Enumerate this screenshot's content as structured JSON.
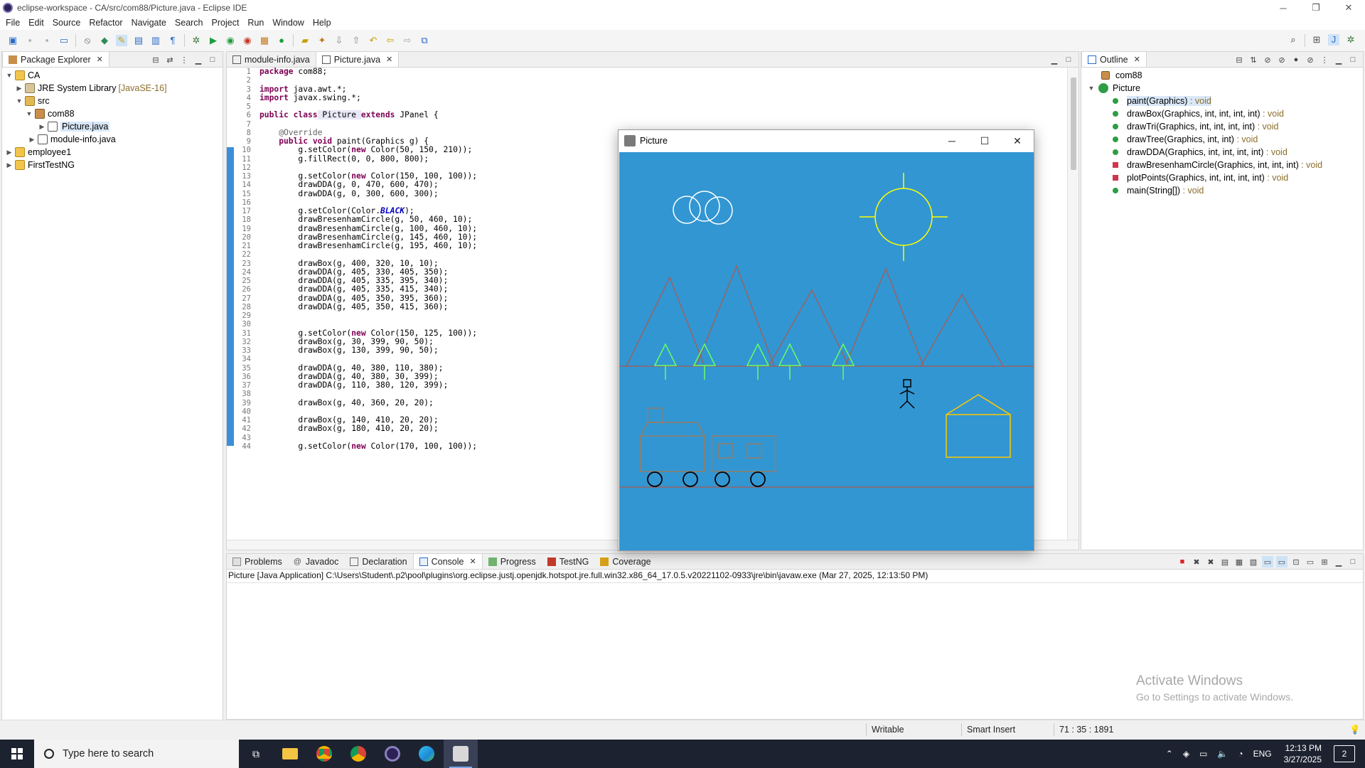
{
  "window": {
    "title": "eclipse-workspace - CA/src/com88/Picture.java - Eclipse IDE",
    "controls": [
      "─",
      "❐",
      "✕"
    ]
  },
  "menu": [
    "File",
    "Edit",
    "Source",
    "Refactor",
    "Navigate",
    "Search",
    "Project",
    "Run",
    "Window",
    "Help"
  ],
  "package_explorer": {
    "tab_label": "Package Explorer",
    "items": [
      {
        "label": "CA",
        "decor": ""
      },
      {
        "label": "JRE System Library",
        "decor": "[JavaSE-16]"
      },
      {
        "label": "src",
        "decor": ""
      },
      {
        "label": "com88",
        "decor": ""
      },
      {
        "label": "Picture.java",
        "decor": ""
      },
      {
        "label": "module-info.java",
        "decor": ""
      },
      {
        "label": "employee1",
        "decor": ""
      },
      {
        "label": "FirstTestNG",
        "decor": ""
      }
    ]
  },
  "editor": {
    "tabs": [
      {
        "label": "module-info.java"
      },
      {
        "label": "Picture.java"
      }
    ],
    "line_numbers": [
      "1",
      "2",
      "3",
      "4",
      "5",
      "6",
      "7",
      "8",
      "9",
      "10",
      "11",
      "12",
      "13",
      "14",
      "15",
      "16",
      "17",
      "18",
      "19",
      "20",
      "21",
      "22",
      "23",
      "24",
      "25",
      "26",
      "27",
      "28",
      "29",
      "30",
      "31",
      "32",
      "33",
      "34",
      "35",
      "36",
      "37",
      "38",
      "39",
      "40",
      "41",
      "42",
      "43",
      "44"
    ],
    "code": {
      "l1_kw": "package",
      "l1_rest": " com88;",
      "l3_kw": "import",
      "l3_rest": " java.awt.*;",
      "l4_kw": "import",
      "l4_rest": " javax.swing.*;",
      "l6_kw1": "public class",
      "l6_mid": " Picture ",
      "l6_kw2": "extends",
      "l6_rest": " JPanel {",
      "l8_ann": "    @Override",
      "l9_kw": "    public void",
      "l9_rest": " paint(Graphics g) {",
      "l10_a": "        g.setColor(",
      "l10_kw": "new",
      "l10_b": " Color(50, 150, 210));",
      "l11": "        g.fillRect(0, 0, 800, 800);",
      "l13_a": "        g.setColor(",
      "l13_kw": "new",
      "l13_b": " Color(150, 100, 100));",
      "l14": "        drawDDA(g, 0, 470, 600, 470);",
      "l15": "        drawDDA(g, 0, 300, 600, 300);",
      "l17_a": "        g.setColor(Color.",
      "l17_c": "BLACK",
      "l17_b": ");",
      "l18": "        drawBresenhamCircle(g, 50, 460, 10);",
      "l19": "        drawBresenhamCircle(g, 100, 460, 10);",
      "l20": "        drawBresenhamCircle(g, 145, 460, 10);",
      "l21": "        drawBresenhamCircle(g, 195, 460, 10);",
      "l23": "        drawBox(g, 400, 320, 10, 10);",
      "l24": "        drawDDA(g, 405, 330, 405, 350);",
      "l25": "        drawDDA(g, 405, 335, 395, 340);",
      "l26": "        drawDDA(g, 405, 335, 415, 340);",
      "l27": "        drawDDA(g, 405, 350, 395, 360);",
      "l28": "        drawDDA(g, 405, 350, 415, 360);",
      "l31_a": "        g.setColor(",
      "l31_kw": "new",
      "l31_b": " Color(150, 125, 100));",
      "l32": "        drawBox(g, 30, 399, 90, 50);",
      "l33": "        drawBox(g, 130, 399, 90, 50);",
      "l35": "        drawDDA(g, 40, 380, 110, 380);",
      "l36": "        drawDDA(g, 40, 380, 30, 399);",
      "l37": "        drawDDA(g, 110, 380, 120, 399);",
      "l39": "        drawBox(g, 40, 360, 20, 20);",
      "l41": "        drawBox(g, 140, 410, 20, 20);",
      "l42": "        drawBox(g, 180, 410, 20, 20);",
      "l44_a": "        g.setColor(",
      "l44_kw": "new",
      "l44_b": " Color(170, 100, 100));"
    }
  },
  "outline": {
    "tab_label": "Outline",
    "package": "com88",
    "class": "Picture",
    "members": [
      {
        "name": "paint(Graphics)",
        "ret": " : void",
        "vis": "public"
      },
      {
        "name": "drawBox(Graphics, int, int, int, int)",
        "ret": " : void",
        "vis": "public"
      },
      {
        "name": "drawTri(Graphics, int, int, int, int)",
        "ret": " : void",
        "vis": "public"
      },
      {
        "name": "drawTree(Graphics, int, int)",
        "ret": " : void",
        "vis": "public"
      },
      {
        "name": "drawDDA(Graphics, int, int, int, int)",
        "ret": " : void",
        "vis": "public"
      },
      {
        "name": "drawBresenhamCircle(Graphics, int, int, int)",
        "ret": " : void",
        "vis": "private"
      },
      {
        "name": "plotPoints(Graphics, int, int, int, int)",
        "ret": " : void",
        "vis": "private"
      },
      {
        "name": "main(String[])",
        "ret": " : void",
        "vis": "public"
      }
    ]
  },
  "console": {
    "tabs": [
      "Problems",
      "Javadoc",
      "Declaration",
      "Console",
      "Progress",
      "TestNG",
      "Coverage"
    ],
    "info": "Picture [Java Application] C:\\Users\\Student\\.p2\\pool\\plugins\\org.eclipse.justj.openjdk.hotspot.jre.full.win32.x86_64_17.0.5.v20221102-0933\\jre\\bin\\javaw.exe  (Mar 27, 2025, 12:13:50 PM)"
  },
  "status": {
    "writable": "Writable",
    "insert_mode": "Smart Insert",
    "position": "71 : 35 : 1891"
  },
  "swing_window": {
    "title": "Picture",
    "controls": [
      "─",
      "☐",
      "✕"
    ]
  },
  "watermark": {
    "line1": "Activate Windows",
    "line2": "Go to Settings to activate Windows."
  },
  "taskbar": {
    "search_placeholder": "Type here to search",
    "lang": "ENG",
    "time": "12:13 PM",
    "date": "3/27/2025",
    "notif_count": "2"
  },
  "colors": {
    "sky": "#3296d2",
    "mountain": "#966464",
    "tree": "#64ff64",
    "sun": "#ffff00",
    "cloud": "#ffffff",
    "house": "#ffc800",
    "train": "#967d64"
  }
}
